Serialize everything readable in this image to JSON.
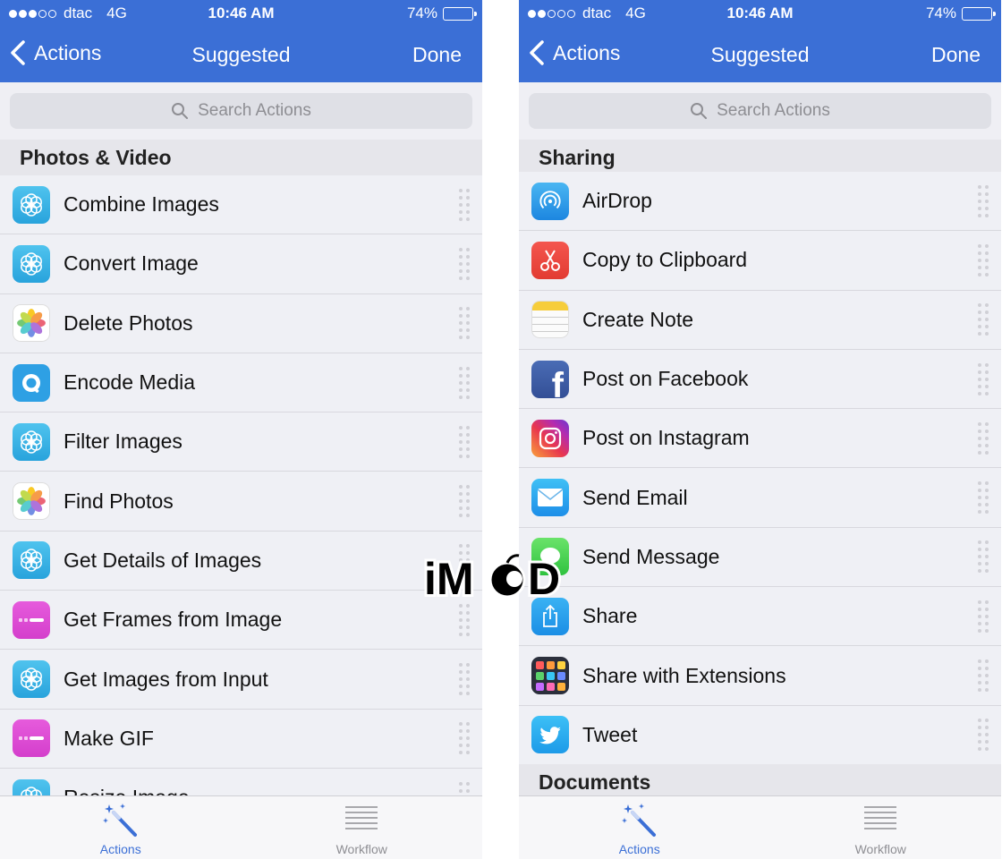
{
  "status_bar": {
    "carrier": "dtac",
    "network": "4G",
    "time": "10:46 AM",
    "battery": "74%",
    "battery_level": 0.74,
    "signal_bars_filled": 3,
    "signal_bars_total": 5
  },
  "left_screen": {
    "nav": {
      "back_label": "Actions",
      "title": "Suggested",
      "done_label": "Done"
    },
    "search_placeholder": "Search Actions",
    "section_title": "Photos & Video",
    "items": [
      {
        "label": "Combine Images",
        "icon": "aperture-icon"
      },
      {
        "label": "Convert Image",
        "icon": "aperture-icon"
      },
      {
        "label": "Delete Photos",
        "icon": "photos-icon"
      },
      {
        "label": "Encode Media",
        "icon": "quicktime-icon"
      },
      {
        "label": "Filter Images",
        "icon": "aperture-icon"
      },
      {
        "label": "Find Photos",
        "icon": "photos-icon"
      },
      {
        "label": "Get Details of Images",
        "icon": "aperture-icon"
      },
      {
        "label": "Get Frames from Image",
        "icon": "frames-icon"
      },
      {
        "label": "Get Images from Input",
        "icon": "aperture-icon"
      },
      {
        "label": "Make GIF",
        "icon": "frames-icon"
      },
      {
        "label": "Resize Image",
        "icon": "aperture-icon"
      }
    ],
    "tabs": [
      {
        "label": "Actions",
        "icon": "magic-wand-icon"
      },
      {
        "label": "Workflow",
        "icon": "list-icon"
      }
    ]
  },
  "right_screen": {
    "nav": {
      "back_label": "Actions",
      "title": "Suggested",
      "done_label": "Done"
    },
    "search_placeholder": "Search Actions",
    "section_title": "Sharing",
    "next_section_title": "Documents",
    "items": [
      {
        "label": "AirDrop",
        "icon": "airdrop-icon"
      },
      {
        "label": "Copy to Clipboard",
        "icon": "scissors-icon"
      },
      {
        "label": "Create Note",
        "icon": "notes-icon"
      },
      {
        "label": "Post on Facebook",
        "icon": "facebook-icon"
      },
      {
        "label": "Post on Instagram",
        "icon": "instagram-icon"
      },
      {
        "label": "Send Email",
        "icon": "mail-icon"
      },
      {
        "label": "Send Message",
        "icon": "messages-icon"
      },
      {
        "label": "Share",
        "icon": "share-icon"
      },
      {
        "label": "Share with Extensions",
        "icon": "extensions-icon"
      },
      {
        "label": "Tweet",
        "icon": "twitter-icon"
      }
    ],
    "tabs": [
      {
        "label": "Actions",
        "icon": "magic-wand-icon"
      },
      {
        "label": "Workflow",
        "icon": "list-icon"
      }
    ]
  },
  "watermark": {
    "text": "iMoD"
  },
  "colors": {
    "nav_blue": "#3b6fd6",
    "list_background": "#eff0f5",
    "tab_active": "#3b6fd6",
    "tab_inactive": "#8e8e93"
  }
}
